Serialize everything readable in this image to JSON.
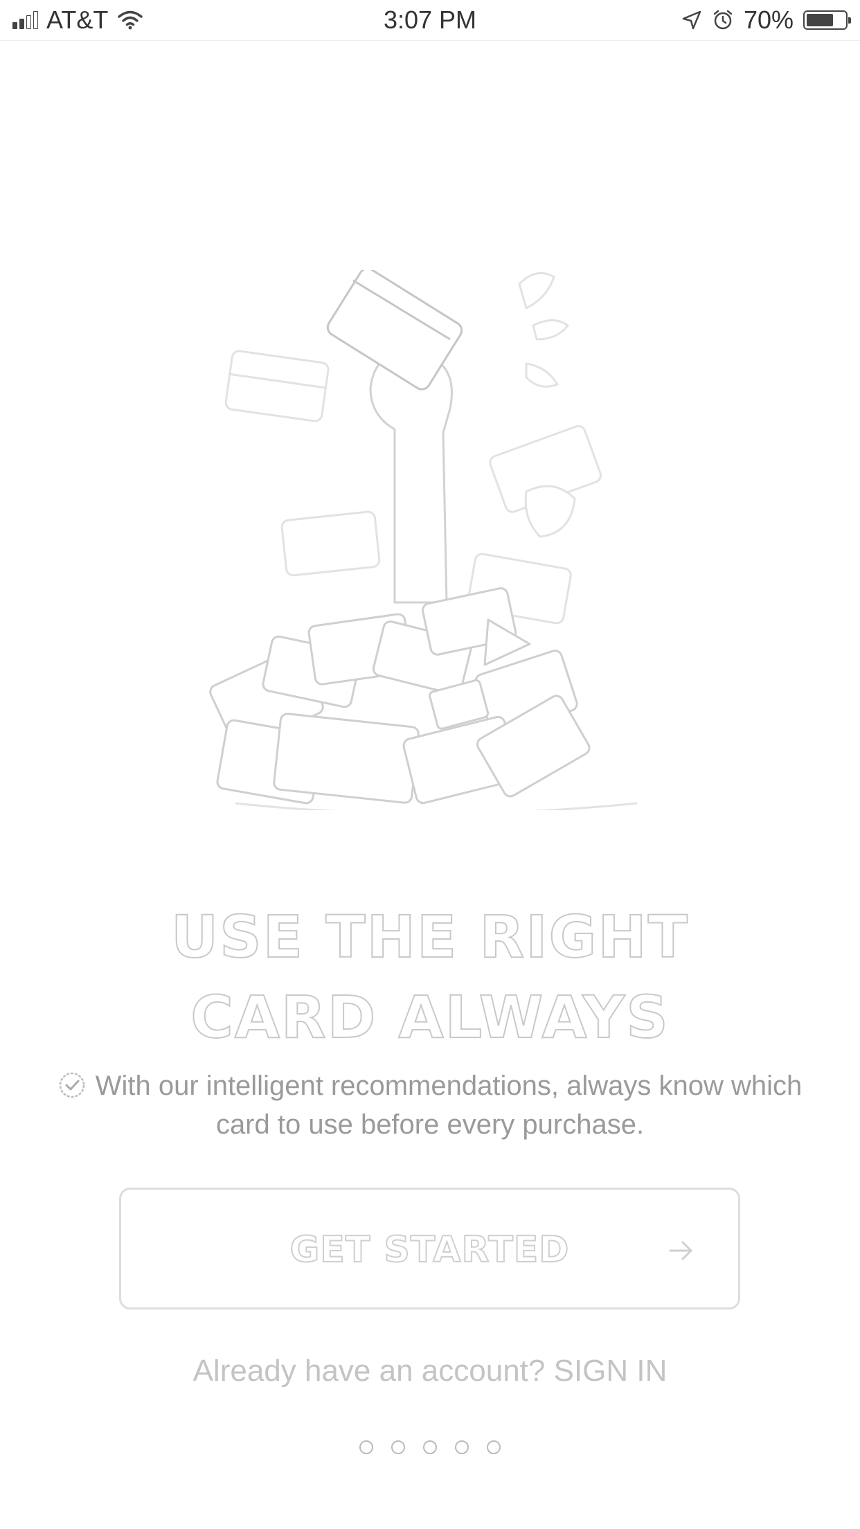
{
  "status_bar": {
    "carrier": "AT&T",
    "time": "3:07 PM",
    "battery_percent": "70%",
    "battery_level": 0.7,
    "icons": [
      "signal-icon",
      "wifi-icon",
      "location-icon",
      "alarm-icon",
      "battery-icon"
    ]
  },
  "onboarding": {
    "illustration": "hand-holding-card-from-pile",
    "headline_line1": "USE THE RIGHT",
    "headline_line2": "CARD ALWAYS",
    "description": "With our intelligent recommendations, always know which card to use before every purchase.",
    "cta_label": "GET STARTED",
    "signin_prompt": "Already have an account?",
    "signin_link": "SIGN IN",
    "page_count": 5
  }
}
